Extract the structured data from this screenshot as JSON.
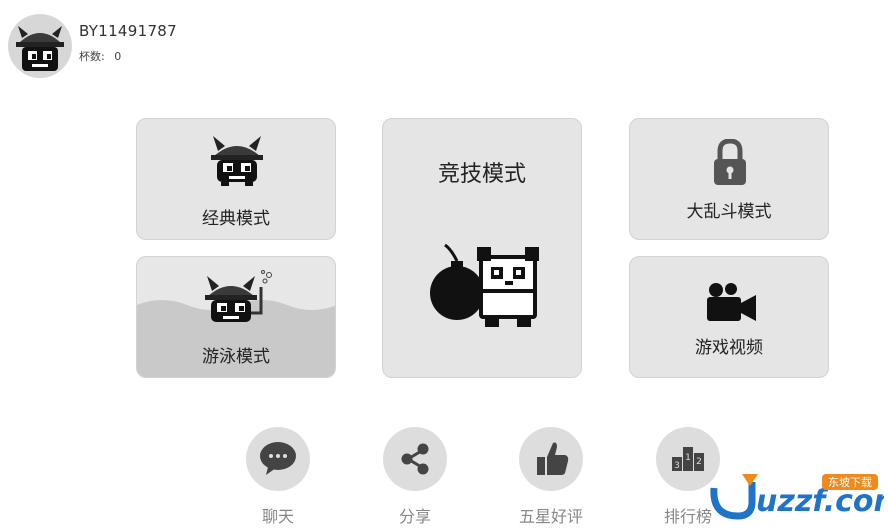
{
  "user": {
    "id": "BY11491787",
    "cups_label": "杯数:",
    "cups_value": "0"
  },
  "modes": {
    "classic": "经典模式",
    "swim": "游泳模式",
    "arena": "竞技模式",
    "brawl": "大乱斗模式",
    "video": "游戏视频"
  },
  "bottom": {
    "chat": "聊天",
    "share": "分享",
    "rate": "五星好评",
    "rank": "排行榜",
    "rank_digits": [
      "3",
      "1",
      "2"
    ]
  },
  "watermark": {
    "text": "uzzf.com",
    "badge": "东坡下载"
  },
  "colors": {
    "card_bg": "#e5e5e5",
    "water": "#c9c9c9",
    "button_bg": "#dddddd",
    "watermark_blue": "#1f73c8",
    "watermark_orange": "#f08a1c"
  },
  "icons": {
    "lock": "lock-icon",
    "camera": "video-camera-icon",
    "chat": "speech-bubble-icon",
    "share": "share-icon",
    "rate": "thumbs-up-icon",
    "rank": "podium-icon"
  }
}
